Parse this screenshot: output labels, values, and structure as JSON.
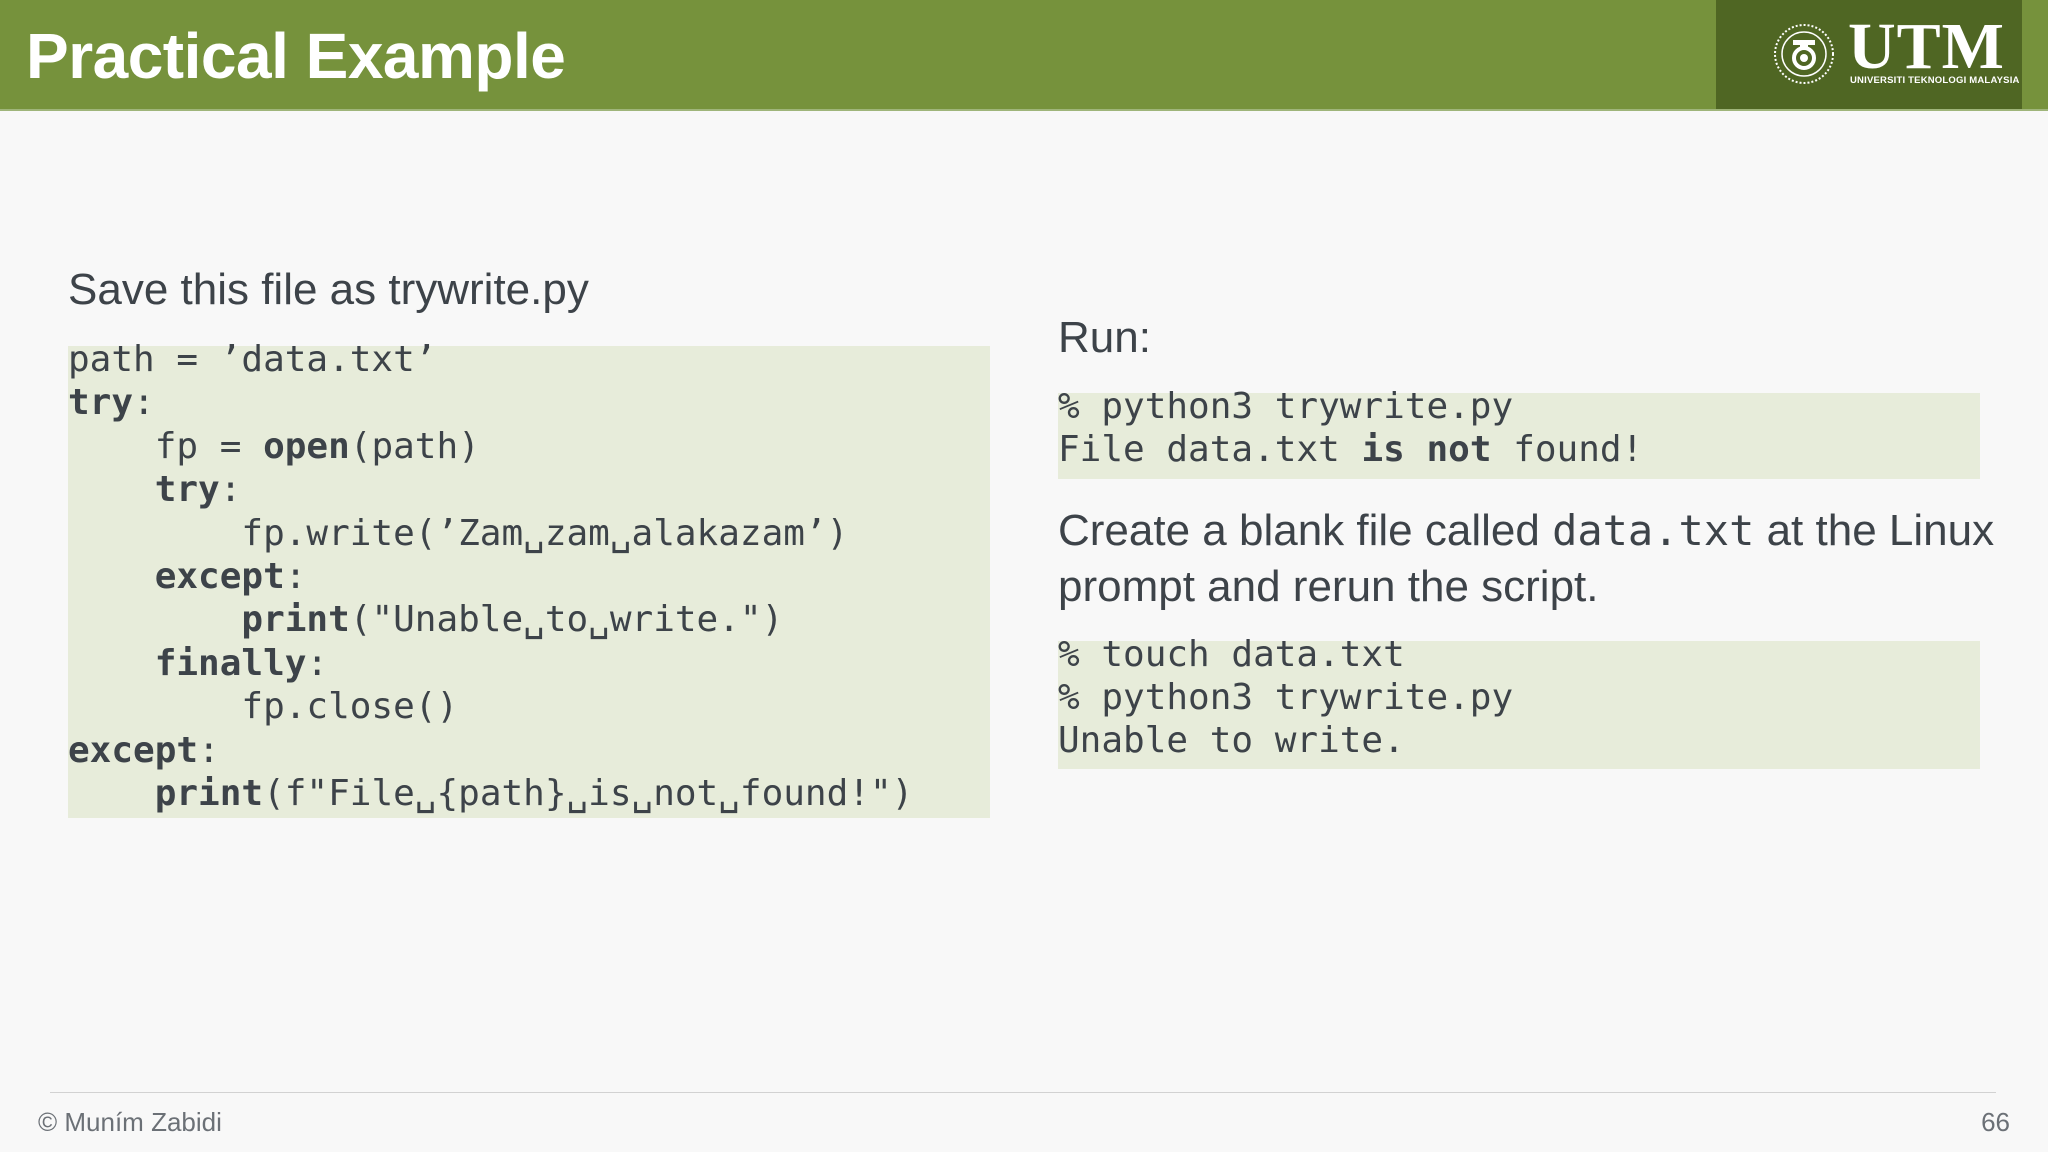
{
  "header": {
    "title": "Practical Example",
    "logo": {
      "name": "UTM",
      "subtitle": "UNIVERSITI TEKNOLOGI MALAYSIA"
    }
  },
  "left": {
    "heading": "Save this file as trywrite.py",
    "code": [
      [
        {
          "t": "path = ’data.txt’",
          "b": false
        }
      ],
      [
        {
          "t": "try",
          "b": true
        },
        {
          "t": ":",
          "b": false
        }
      ],
      [
        {
          "t": "    fp = ",
          "b": false
        },
        {
          "t": "open",
          "b": true
        },
        {
          "t": "(path)",
          "b": false
        }
      ],
      [
        {
          "t": "    ",
          "b": false
        },
        {
          "t": "try",
          "b": true
        },
        {
          "t": ":",
          "b": false
        }
      ],
      [
        {
          "t": "        fp.write(’Zam␣zam␣alakazam’)",
          "b": false
        }
      ],
      [
        {
          "t": "    ",
          "b": false
        },
        {
          "t": "except",
          "b": true
        },
        {
          "t": ":",
          "b": false
        }
      ],
      [
        {
          "t": "        ",
          "b": false
        },
        {
          "t": "print",
          "b": true
        },
        {
          "t": "(\"Unable␣to␣write.\")",
          "b": false
        }
      ],
      [
        {
          "t": "    ",
          "b": false
        },
        {
          "t": "finally",
          "b": true
        },
        {
          "t": ":",
          "b": false
        }
      ],
      [
        {
          "t": "        fp.close()",
          "b": false
        }
      ],
      [
        {
          "t": "except",
          "b": true
        },
        {
          "t": ":",
          "b": false
        }
      ],
      [
        {
          "t": "    ",
          "b": false
        },
        {
          "t": "print",
          "b": true
        },
        {
          "t": "(f\"File␣{path}␣is␣not␣found!\")",
          "b": false
        }
      ]
    ]
  },
  "right": {
    "run_label": "Run:",
    "code1": [
      [
        {
          "t": "% python3 trywrite.py",
          "b": false
        }
      ],
      [
        {
          "t": "File data.txt ",
          "b": false
        },
        {
          "t": "is",
          "b": true
        },
        {
          "t": " ",
          "b": false
        },
        {
          "t": "not",
          "b": true
        },
        {
          "t": " found!",
          "b": false
        }
      ]
    ],
    "para_part1": "Create a blank file called ",
    "para_code": "data.txt",
    "para_part2": " at the Linux prompt and rerun the script.",
    "code2": [
      [
        {
          "t": "% touch data.txt",
          "b": false
        }
      ],
      [
        {
          "t": "% python3 trywrite.py",
          "b": false
        }
      ],
      [
        {
          "t": "Unable to write.",
          "b": false
        }
      ]
    ]
  },
  "footer": {
    "author": "© Muním Zabidi",
    "page": "66"
  },
  "colors": {
    "header": "#76923c",
    "logo_bg": "#4f6623",
    "code_bg": "#e7ecda",
    "text": "#3d4349"
  }
}
